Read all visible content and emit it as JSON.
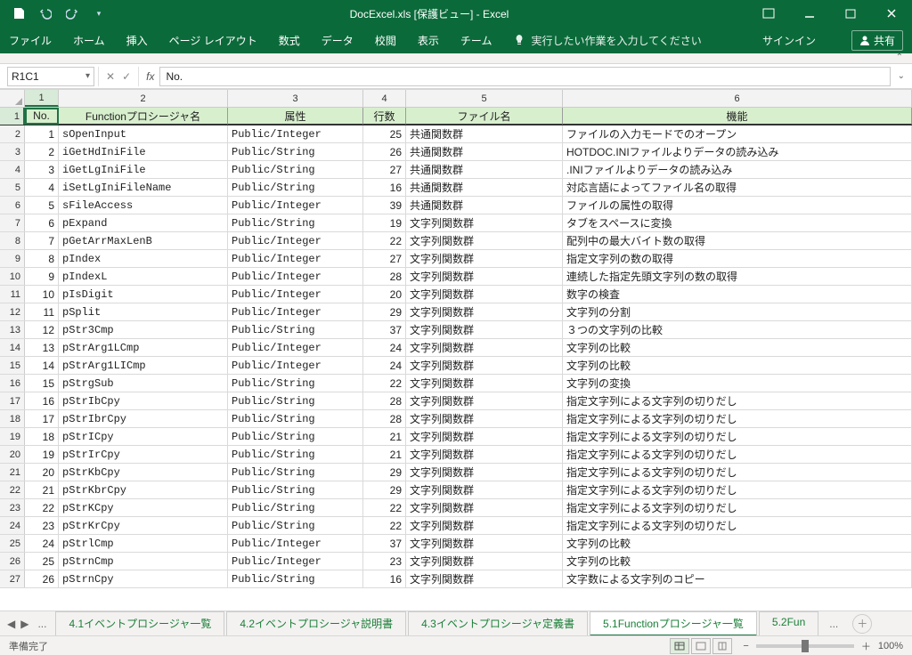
{
  "title": "DocExcel.xls  [保護ビュー] - Excel",
  "ribbon": {
    "tabs": [
      "ファイル",
      "ホーム",
      "挿入",
      "ページ レイアウト",
      "数式",
      "データ",
      "校閲",
      "表示",
      "チーム"
    ],
    "tellme": "実行したい作業を入力してください",
    "signin": "サインイン",
    "share": "共有"
  },
  "namebox": "R1C1",
  "formula": "No.",
  "columns": [
    "1",
    "2",
    "3",
    "4",
    "5",
    "6"
  ],
  "headers": {
    "c1": "No.",
    "c2": "Functionプロシージャ名",
    "c3": "属性",
    "c4": "行数",
    "c5": "ファイル名",
    "c6": "機能"
  },
  "rows": [
    {
      "n": 1,
      "name": "sOpenInput",
      "attr": "Public/Integer",
      "lines": 25,
      "file": "共通関数群",
      "func": "ファイルの入力モードでのオープン"
    },
    {
      "n": 2,
      "name": "iGetHdIniFile",
      "attr": "Public/String",
      "lines": 26,
      "file": "共通関数群",
      "func": "HOTDOC.INIファイルよりデータの読み込み"
    },
    {
      "n": 3,
      "name": "iGetLgIniFile",
      "attr": "Public/String",
      "lines": 27,
      "file": "共通関数群",
      "func": ".INIファイルよりデータの読み込み"
    },
    {
      "n": 4,
      "name": "iSetLgIniFileName",
      "attr": "Public/String",
      "lines": 16,
      "file": "共通関数群",
      "func": "対応言語によってファイル名の取得"
    },
    {
      "n": 5,
      "name": "sFileAccess",
      "attr": "Public/Integer",
      "lines": 39,
      "file": "共通関数群",
      "func": "ファイルの属性の取得"
    },
    {
      "n": 6,
      "name": "pExpand",
      "attr": "Public/String",
      "lines": 19,
      "file": "文字列関数群",
      "func": "タブをスペースに変換"
    },
    {
      "n": 7,
      "name": "pGetArrMaxLenB",
      "attr": "Public/Integer",
      "lines": 22,
      "file": "文字列関数群",
      "func": "配列中の最大バイト数の取得"
    },
    {
      "n": 8,
      "name": "pIndex",
      "attr": "Public/Integer",
      "lines": 27,
      "file": "文字列関数群",
      "func": "指定文字列の数の取得"
    },
    {
      "n": 9,
      "name": "pIndexL",
      "attr": "Public/Integer",
      "lines": 28,
      "file": "文字列関数群",
      "func": "連続した指定先頭文字列の数の取得"
    },
    {
      "n": 10,
      "name": "pIsDigit",
      "attr": "Public/Integer",
      "lines": 20,
      "file": "文字列関数群",
      "func": "数字の検査"
    },
    {
      "n": 11,
      "name": "pSplit",
      "attr": "Public/Integer",
      "lines": 29,
      "file": "文字列関数群",
      "func": "文字列の分割"
    },
    {
      "n": 12,
      "name": "pStr3Cmp",
      "attr": "Public/String",
      "lines": 37,
      "file": "文字列関数群",
      "func": "３つの文字列の比較"
    },
    {
      "n": 13,
      "name": "pStrArg1LCmp",
      "attr": "Public/Integer",
      "lines": 24,
      "file": "文字列関数群",
      "func": "文字列の比較"
    },
    {
      "n": 14,
      "name": "pStrArg1LICmp",
      "attr": "Public/Integer",
      "lines": 24,
      "file": "文字列関数群",
      "func": "文字列の比較"
    },
    {
      "n": 15,
      "name": "pStrgSub",
      "attr": "Public/String",
      "lines": 22,
      "file": "文字列関数群",
      "func": "文字列の変換"
    },
    {
      "n": 16,
      "name": "pStrIbCpy",
      "attr": "Public/String",
      "lines": 28,
      "file": "文字列関数群",
      "func": "指定文字列による文字列の切りだし"
    },
    {
      "n": 17,
      "name": "pStrIbrCpy",
      "attr": "Public/String",
      "lines": 28,
      "file": "文字列関数群",
      "func": "指定文字列による文字列の切りだし"
    },
    {
      "n": 18,
      "name": "pStrICpy",
      "attr": "Public/String",
      "lines": 21,
      "file": "文字列関数群",
      "func": "指定文字列による文字列の切りだし"
    },
    {
      "n": 19,
      "name": "pStrIrCpy",
      "attr": "Public/String",
      "lines": 21,
      "file": "文字列関数群",
      "func": "指定文字列による文字列の切りだし"
    },
    {
      "n": 20,
      "name": "pStrKbCpy",
      "attr": "Public/String",
      "lines": 29,
      "file": "文字列関数群",
      "func": "指定文字列による文字列の切りだし"
    },
    {
      "n": 21,
      "name": "pStrKbrCpy",
      "attr": "Public/String",
      "lines": 29,
      "file": "文字列関数群",
      "func": "指定文字列による文字列の切りだし"
    },
    {
      "n": 22,
      "name": "pStrKCpy",
      "attr": "Public/String",
      "lines": 22,
      "file": "文字列関数群",
      "func": "指定文字列による文字列の切りだし"
    },
    {
      "n": 23,
      "name": "pStrKrCpy",
      "attr": "Public/String",
      "lines": 22,
      "file": "文字列関数群",
      "func": "指定文字列による文字列の切りだし"
    },
    {
      "n": 24,
      "name": "pStrlCmp",
      "attr": "Public/Integer",
      "lines": 37,
      "file": "文字列関数群",
      "func": "文字列の比較"
    },
    {
      "n": 25,
      "name": "pStrnCmp",
      "attr": "Public/Integer",
      "lines": 23,
      "file": "文字列関数群",
      "func": "文字列の比較"
    },
    {
      "n": 26,
      "name": "pStrnCpy",
      "attr": "Public/String",
      "lines": 16,
      "file": "文字列関数群",
      "func": "文字数による文字列のコピー"
    }
  ],
  "sheets": {
    "items": [
      "4.1イベントプロシージャ一覧",
      "4.2イベントプロシージャ説明書",
      "4.3イベントプロシージャ定義書",
      "5.1Functionプロシージャ一覧",
      "5.2Fun"
    ],
    "active": 3,
    "ellipsis_left": "...",
    "ellipsis_right": "..."
  },
  "status": {
    "ready": "準備完了",
    "zoom": "100%"
  }
}
